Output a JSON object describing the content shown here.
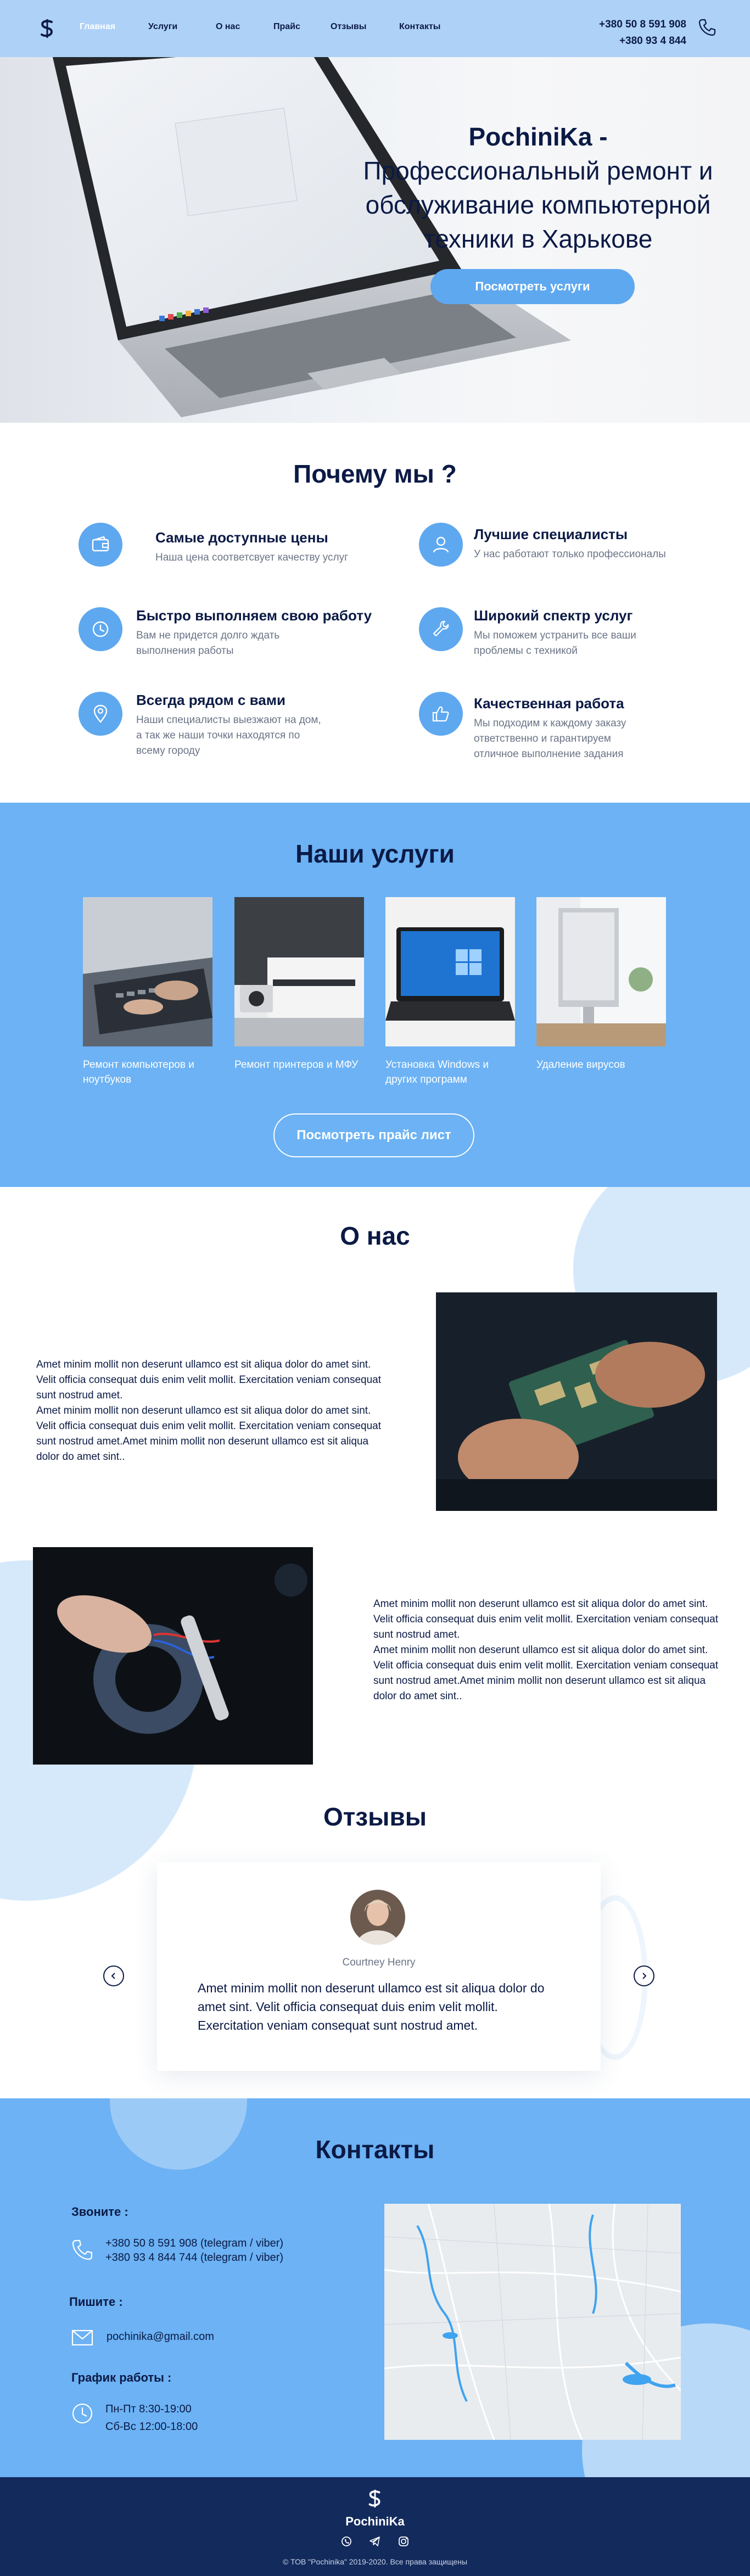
{
  "header": {
    "nav": [
      "Главная",
      "Услуги",
      "О нас",
      "Прайс",
      "Отзывы",
      "Контакты"
    ],
    "phone_1": "+380 50 8 591 908",
    "phone_2": "+380 93 4 844"
  },
  "hero": {
    "brand": "PochiniKa -",
    "title": "Профессиональный ремонт и обслуживание компьютерной техники в Харькове",
    "button": "Посмотреть услуги"
  },
  "why": {
    "title": "Почему мы ?",
    "features": [
      {
        "icon": "wallet-icon",
        "title": "Самые доступные цены",
        "desc": "Наша цена соответсвует качеству услуг"
      },
      {
        "icon": "user-icon",
        "title": "Лучшие специалисты",
        "desc": "У нас работают только профессионалы"
      },
      {
        "icon": "clock-icon",
        "title": "Быстро выполняем свою работу",
        "desc": "Вам не придется долго ждать выполнения работы"
      },
      {
        "icon": "wrench-icon",
        "title": "Широкий спектр услуг",
        "desc": "Мы поможем устранить все ваши проблемы с техникой"
      },
      {
        "icon": "location-pin-icon",
        "title": "Всегда рядом с вами",
        "desc": "Наши специалисты выезжают на дом, а так же наши точки находятся по всему городу"
      },
      {
        "icon": "thumbs-up-icon",
        "title": "Качественная работа",
        "desc": "Мы подходим к каждому заказу ответственно и гарантируем отличное выполнение задания"
      }
    ]
  },
  "services": {
    "title": "Наши услуги",
    "items": [
      {
        "label": "Ремонт компьютеров и ноутбуков"
      },
      {
        "label": "Ремонт принтеров и МФУ"
      },
      {
        "label": "Установка Windows и других программ"
      },
      {
        "label": "Удаление вирусов"
      }
    ],
    "button": "Посмотреть прайс лист"
  },
  "about": {
    "title": "О нас",
    "text_1": "Amet minim mollit non deserunt ullamco est sit aliqua dolor do amet sint. Velit officia consequat duis enim velit mollit. Exercitation veniam consequat sunt nostrud amet.\nAmet minim mollit non deserunt ullamco est sit aliqua dolor do amet sint. Velit officia consequat duis enim velit mollit. Exercitation veniam consequat sunt nostrud amet.Amet minim mollit non deserunt ullamco est sit aliqua dolor do amet sint..",
    "text_2": "Amet minim mollit non deserunt ullamco est sit aliqua dolor do amet sint. Velit officia consequat duis enim velit mollit. Exercitation veniam consequat sunt nostrud amet.\nAmet minim mollit non deserunt ullamco est sit aliqua dolor do amet sint. Velit officia consequat duis enim velit mollit. Exercitation veniam consequat sunt nostrud amet.Amet minim mollit non deserunt ullamco est sit aliqua dolor do amet sint.."
  },
  "reviews": {
    "title": "Отзывы",
    "name": "Courtney Henry",
    "text": "Amet minim mollit non deserunt ullamco est sit aliqua dolor do amet sint. Velit officia consequat duis enim velit mollit. Exercitation veniam consequat sunt nostrud amet."
  },
  "contacts": {
    "title": "Контакты",
    "call_head": "Звоните :",
    "phone_1": "+380 50 8 591 908 (telegram / viber)",
    "phone_2": "+380 93 4 844 744 (telegram / viber)",
    "write_head": "Пишите :",
    "email": "pochinika@gmail.com",
    "hours_head": "График работы :",
    "hours_1": "Пн-Пт 8:30-19:00",
    "hours_2": "Сб-Вс 12:00-18:00"
  },
  "footer": {
    "brand": "PochiniKa",
    "copyright": "© ТОВ \"Pochinika\" 2019-2020. Все права защищены"
  },
  "colors": {
    "accent": "#5ea8f0",
    "section_blue": "#6cb2f4",
    "header_blue": "#aed1f7",
    "dark_text": "#0b1a45",
    "footer_navy": "#132a5c"
  }
}
